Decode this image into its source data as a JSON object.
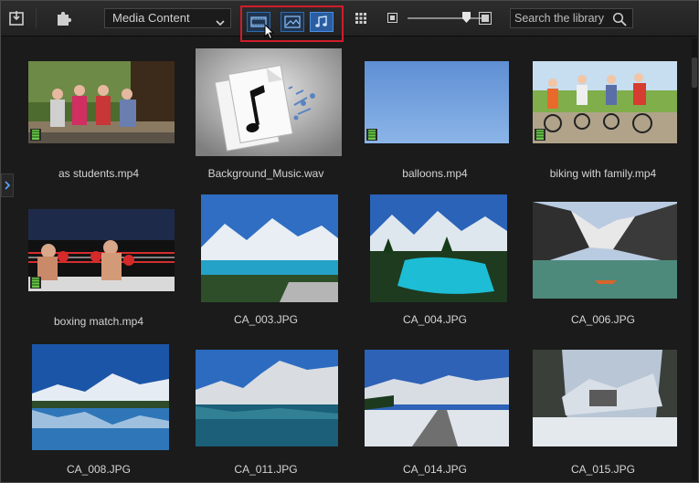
{
  "toolbar": {
    "import_icon": "import-media-icon",
    "plugin_icon": "plugin-puzzle-icon",
    "content_dropdown": "Media Content",
    "filter_buttons": [
      "video-filter-icon",
      "image-filter-icon",
      "audio-filter-icon"
    ],
    "grid_icon": "view-grid-icon",
    "search_placeholder": "Search the library"
  },
  "media_items": [
    {
      "name": "as students.mp4",
      "kind": "video"
    },
    {
      "name": "Background_Music.wav",
      "kind": "audio"
    },
    {
      "name": "balloons.mp4",
      "kind": "video"
    },
    {
      "name": "biking with family.mp4",
      "kind": "video"
    },
    {
      "name": "boxing match.mp4",
      "kind": "video"
    },
    {
      "name": "CA_003.JPG",
      "kind": "image"
    },
    {
      "name": "CA_004.JPG",
      "kind": "image"
    },
    {
      "name": "CA_006.JPG",
      "kind": "image"
    },
    {
      "name": "CA_008.JPG",
      "kind": "image"
    },
    {
      "name": "CA_011.JPG",
      "kind": "image"
    },
    {
      "name": "CA_014.JPG",
      "kind": "image"
    },
    {
      "name": "CA_015.JPG",
      "kind": "image"
    }
  ],
  "colors": {
    "highlight_border": "#d11c2a",
    "filter_accent": "#2a5ea0"
  }
}
